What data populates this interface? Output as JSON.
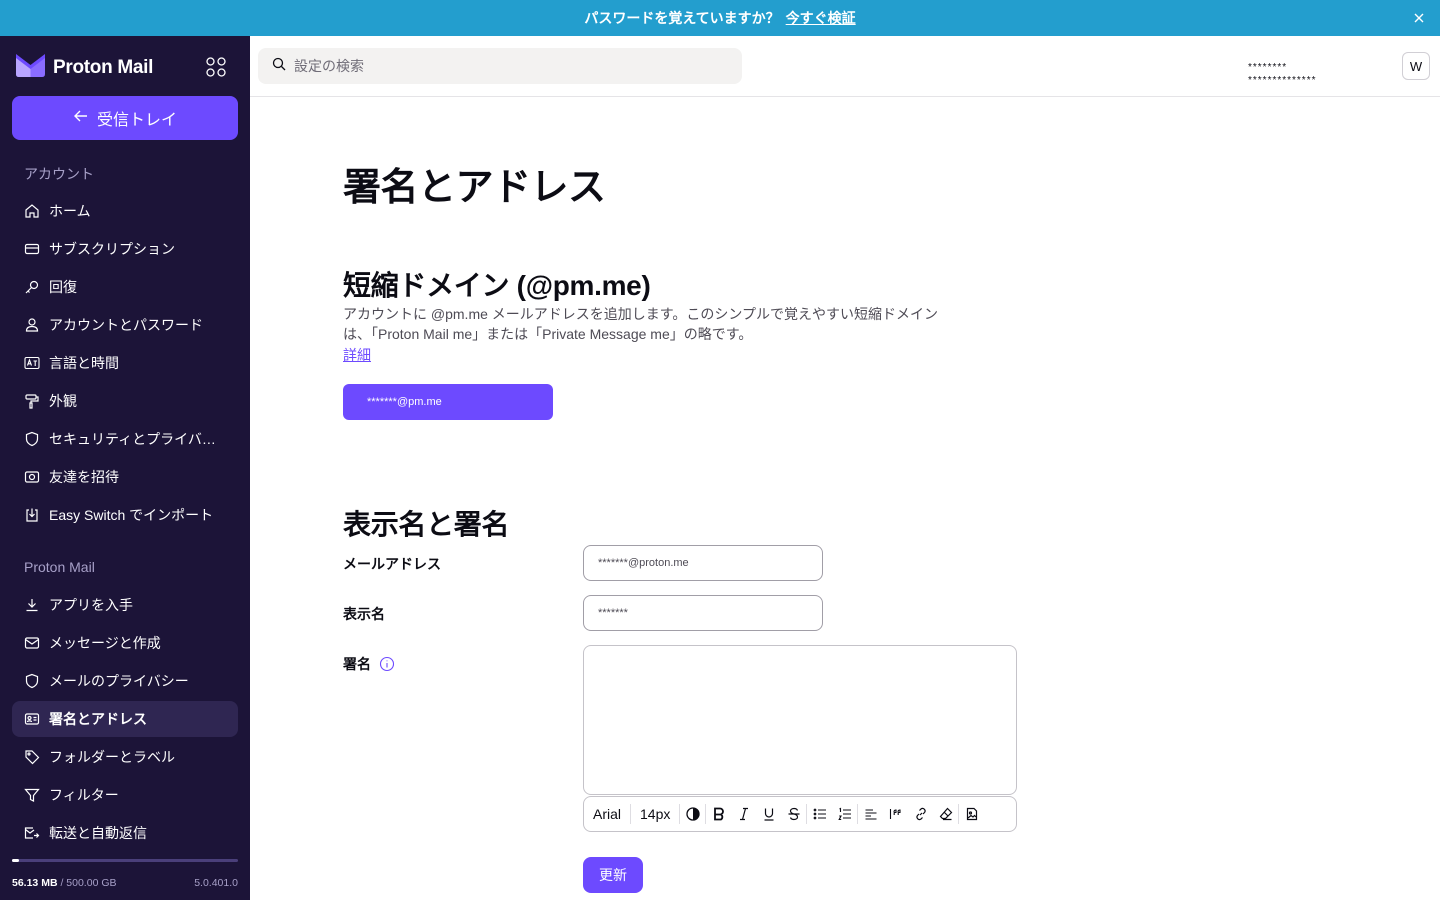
{
  "banner": {
    "text": "パスワードを覚えていますか？",
    "link": "今すぐ検証"
  },
  "sidebar": {
    "brand": "Proton Mail",
    "inbox_button": "受信トレイ",
    "account_section": "アカウント",
    "account_items": [
      {
        "label": "ホーム",
        "icon": "home-icon"
      },
      {
        "label": "サブスクリプション",
        "icon": "credit-card-icon"
      },
      {
        "label": "回復",
        "icon": "key-icon"
      },
      {
        "label": "アカウントとパスワード",
        "icon": "user-icon"
      },
      {
        "label": "言語と時間",
        "icon": "language-icon"
      },
      {
        "label": "外観",
        "icon": "paint-roller-icon"
      },
      {
        "label": "セキュリティとプライバシー",
        "icon": "shield-icon"
      },
      {
        "label": "友達を招待",
        "icon": "gift-icon"
      },
      {
        "label": "Easy Switch でインポート",
        "icon": "import-icon"
      }
    ],
    "mail_section": "Proton Mail",
    "mail_items": [
      {
        "label": "アプリを入手",
        "icon": "download-icon"
      },
      {
        "label": "メッセージと作成",
        "icon": "envelope-icon"
      },
      {
        "label": "メールのプライバシー",
        "icon": "shield-icon"
      },
      {
        "label": "署名とアドレス",
        "icon": "id-card-icon",
        "active": true
      },
      {
        "label": "フォルダーとラベル",
        "icon": "tag-icon"
      },
      {
        "label": "フィルター",
        "icon": "filter-icon"
      },
      {
        "label": "転送と自動返信",
        "icon": "forward-icon"
      }
    ],
    "storage_used": "56.13 MB",
    "storage_total": "/ 500.00 GB",
    "storage_fraction": 0.03,
    "version": "5.0.401.0"
  },
  "topbar": {
    "search_placeholder": "設定の検索",
    "user_name": "********",
    "user_email": "**************",
    "avatar_initial": "W"
  },
  "main": {
    "title": "署名とアドレス",
    "short_domain": {
      "heading": "短縮ドメイン (@pm.me)",
      "description": "アカウントに @pm.me メールアドレスを追加します。このシンプルで覚えやすい短縮ドメインは、「Proton Mail me」または「Private Message me」の略です。",
      "learn_more": "詳細",
      "address_button": "*******@pm.me"
    },
    "display_name": {
      "heading": "表示名と署名",
      "email_label": "メールアドレス",
      "email_value": "*******@proton.me",
      "name_label": "表示名",
      "name_value": "*******",
      "signature_label": "署名",
      "toolbar_font": "Arial",
      "toolbar_size": "14px",
      "update_button": "更新"
    }
  },
  "colors": {
    "accent": "#6d4aff",
    "sidebar_bg": "#1c1438",
    "banner_bg": "#239ece"
  }
}
